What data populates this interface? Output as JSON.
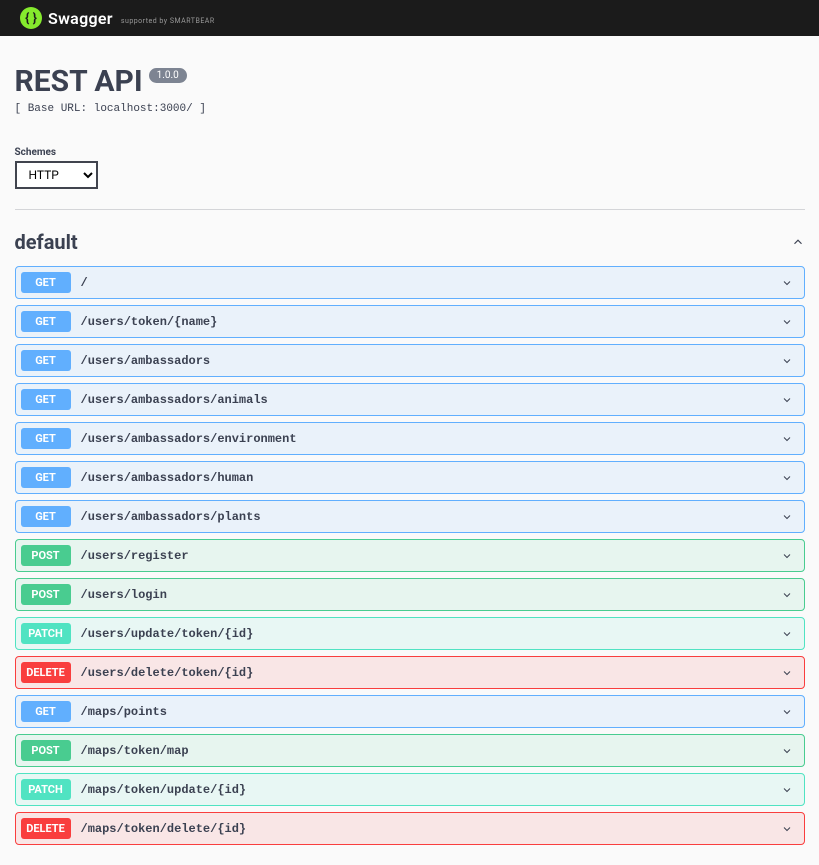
{
  "logo": {
    "text": "Swagger",
    "sub": "supported by SMARTBEAR"
  },
  "header": {
    "title": "REST API",
    "version": "1.0.0",
    "base_url": "[ Base URL: localhost:3000/ ]"
  },
  "schemes": {
    "label": "Schemes",
    "selected": "HTTP",
    "options": [
      "HTTP"
    ]
  },
  "section": {
    "name": "default"
  },
  "operations": [
    {
      "method": "GET",
      "path": "/"
    },
    {
      "method": "GET",
      "path": "/users/token/{name}"
    },
    {
      "method": "GET",
      "path": "/users/ambassadors"
    },
    {
      "method": "GET",
      "path": "/users/ambassadors/animals"
    },
    {
      "method": "GET",
      "path": "/users/ambassadors/environment"
    },
    {
      "method": "GET",
      "path": "/users/ambassadors/human"
    },
    {
      "method": "GET",
      "path": "/users/ambassadors/plants"
    },
    {
      "method": "POST",
      "path": "/users/register"
    },
    {
      "method": "POST",
      "path": "/users/login"
    },
    {
      "method": "PATCH",
      "path": "/users/update/token/{id}"
    },
    {
      "method": "DELETE",
      "path": "/users/delete/token/{id}"
    },
    {
      "method": "GET",
      "path": "/maps/points"
    },
    {
      "method": "POST",
      "path": "/maps/token/map"
    },
    {
      "method": "PATCH",
      "path": "/maps/token/update/{id}"
    },
    {
      "method": "DELETE",
      "path": "/maps/token/delete/{id}"
    }
  ]
}
